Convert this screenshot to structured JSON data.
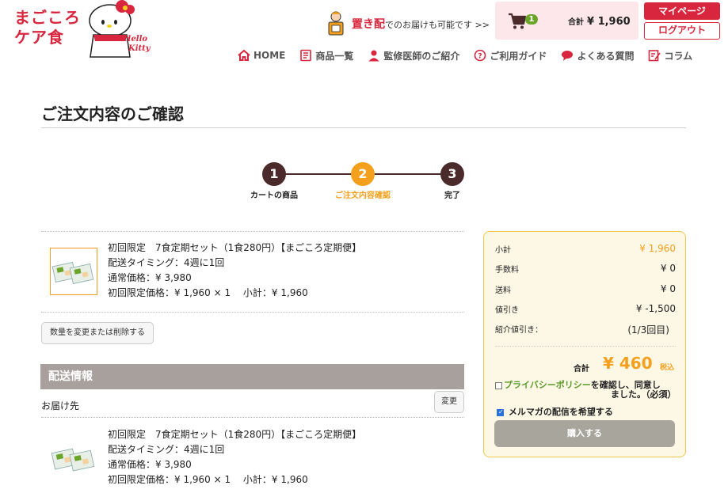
{
  "header": {
    "logo_line1": "まごころ",
    "logo_line2": "ケア食",
    "kitty_line1": "Hello",
    "kitty_line2": "Kitty",
    "okihai_em": "置き配",
    "okihai_text": "でのお届けも可能です >>",
    "cart_count": "1",
    "cart_total_label": "合計",
    "cart_total_value": "¥ 1,960",
    "mypage_label": "マイページ",
    "logout_label": "ログアウト"
  },
  "nav": {
    "home": "HOME",
    "products": "商品一覧",
    "doctor": "監修医師のご紹介",
    "guide": "ご利用ガイド",
    "faq": "よくある質問",
    "column": "コラム"
  },
  "page": {
    "title": "ご注文内容のご確認"
  },
  "steps": [
    {
      "num": "1",
      "label": "カートの商品"
    },
    {
      "num": "2",
      "label": "ご注文内容確認"
    },
    {
      "num": "3",
      "label": "完了"
    }
  ],
  "item": {
    "name": "初回限定　7食定期セット（1食280円）【まごころ定期便】",
    "timing": "配送タイミング：4週に1回",
    "regular_price": "通常価格：¥ 3,980",
    "first_price": "初回限定価格：¥ 1,960 × 1　 小計：¥ 1,960"
  },
  "actions": {
    "change_qty": "数量を変更または削除する",
    "change": "変更"
  },
  "shipping": {
    "header": "配送情報",
    "destination_label": "お届け先"
  },
  "summary": {
    "subtotal_label": "小計",
    "subtotal_value": "¥ 1,960",
    "fee_label": "手数料",
    "fee_value": "¥ 0",
    "shipping_label": "送料",
    "shipping_value": "¥ 0",
    "discount_label": "値引き",
    "discount_value": "¥ -1,500",
    "referral_label": "紹介値引き：",
    "referral_value": "(1/3回目)",
    "total_label": "合計",
    "total_value": "¥ 460",
    "tax_label": "税込",
    "privacy_link": "プライバシーポリシー",
    "privacy_text1": "を確認し、同意し",
    "privacy_text2": "ました。（必須）",
    "mailmag_label": "メルマガの配信を希望する",
    "buy_label": "購入する"
  },
  "colors": {
    "brand_red": "#d7263d",
    "accent_orange": "#f4a01c",
    "step_dark": "#4a2a2a",
    "nav_icon_red": "#d7263d",
    "header_gray": "#a7a09d"
  }
}
